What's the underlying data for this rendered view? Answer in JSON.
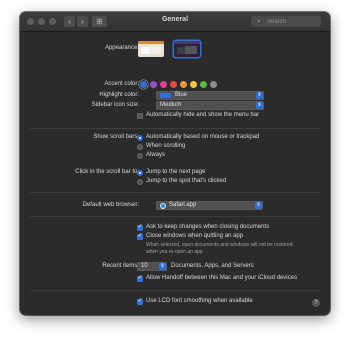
{
  "window": {
    "title": "General",
    "search_placeholder": "Search",
    "grid_button": "⊞",
    "back_button": "‹",
    "forward_button": "›"
  },
  "appearance": {
    "label": "Appearance:",
    "options": [
      "Light",
      "Dark"
    ],
    "selected": "Dark"
  },
  "accent_color": {
    "label": "Accent color:",
    "colors": [
      "#2f6fd8",
      "#9a4fd1",
      "#e0409a",
      "#ea4848",
      "#f29a36",
      "#f4cd3c",
      "#5cb946",
      "#8c8c8c"
    ],
    "selected_index": 0
  },
  "highlight_color": {
    "label": "Highlight color:",
    "value": "Blue",
    "swatch": "#2f6fd8"
  },
  "sidebar_icon_size": {
    "label": "Sidebar icon size:",
    "value": "Medium"
  },
  "menu_bar": {
    "label": "Automatically hide and show the menu bar",
    "checked": false
  },
  "scroll_bars": {
    "label": "Show scroll bars:",
    "options": [
      "Automatically based on mouse or trackpad",
      "When scrolling",
      "Always"
    ],
    "selected_index": 0
  },
  "click_scroll_bar": {
    "label": "Click in the scroll bar to:",
    "options": [
      "Jump to the next page",
      "Jump to the spot that's clicked"
    ],
    "selected_index": 0
  },
  "default_browser": {
    "label": "Default web browser:",
    "value": "Safari.app"
  },
  "documents": {
    "ask_keep_changes": "Ask to keep changes when closing documents",
    "close_windows": "Close windows when quitting an app",
    "close_windows_note_1": "When selected, open documents and windows will not be restored",
    "close_windows_note_2": "when you re-open an app."
  },
  "recent_items": {
    "label": "Recent items:",
    "value": "10",
    "suffix": "Documents, Apps, and Servers"
  },
  "handoff": {
    "label": "Allow Handoff between this Mac and your iCloud devices",
    "checked": true
  },
  "font_smoothing": {
    "label": "Use LCD font smoothing when available",
    "checked": true
  },
  "help_button": "?"
}
